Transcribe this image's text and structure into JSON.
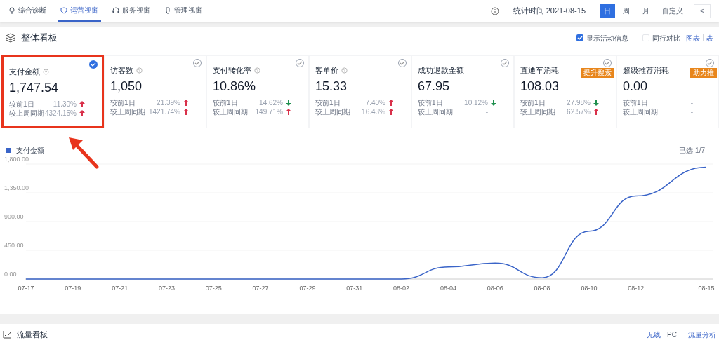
{
  "nav_tabs": [
    {
      "label": "综合诊断",
      "selected": false
    },
    {
      "label": "运营视窗",
      "selected": true
    },
    {
      "label": "服务视窗",
      "selected": false
    },
    {
      "label": "管理视窗",
      "selected": false
    }
  ],
  "stat_time": "统计时间 2021-08-15",
  "period_tabs": [
    {
      "label": "日",
      "selected": true
    },
    {
      "label": "周",
      "selected": false
    },
    {
      "label": "月",
      "selected": false
    },
    {
      "label": "自定义",
      "selected": false
    }
  ],
  "back_button": "<",
  "section": {
    "title": "整体看板",
    "show_activity": {
      "label": "显示活动信息",
      "checked": true
    },
    "peer_compare": {
      "label": "同行对比",
      "checked": false
    },
    "view_links": [
      "图表",
      "表"
    ]
  },
  "metrics": [
    {
      "label": "支付金额",
      "help": true,
      "value": "1,747.54",
      "selected": true,
      "highlighted": true,
      "rows": [
        {
          "label": "较前1日",
          "value": "11.30%",
          "increase": true
        },
        {
          "label": "较上周同期",
          "value": "4324.15%",
          "increase": true
        }
      ]
    },
    {
      "label": "访客数",
      "help": true,
      "value": "1,050",
      "selected": false,
      "highlighted": false,
      "rows": [
        {
          "label": "较前1日",
          "value": "21.39%",
          "increase": true
        },
        {
          "label": "较上周同期",
          "value": "1421.74%",
          "increase": true
        }
      ]
    },
    {
      "label": "支付转化率",
      "help": true,
      "value": "10.86%",
      "selected": false,
      "highlighted": false,
      "rows": [
        {
          "label": "较前1日",
          "value": "14.62%",
          "increase": false
        },
        {
          "label": "较上周同期",
          "value": "149.71%",
          "increase": true
        }
      ]
    },
    {
      "label": "客单价",
      "help": true,
      "value": "15.33",
      "selected": false,
      "highlighted": false,
      "rows": [
        {
          "label": "较前1日",
          "value": "7.40%",
          "increase": true
        },
        {
          "label": "较上周同期",
          "value": "16.43%",
          "increase": true
        }
      ]
    },
    {
      "label": "成功退款金额",
      "help": false,
      "value": "67.95",
      "selected": false,
      "highlighted": false,
      "rows": [
        {
          "label": "较前1日",
          "value": "10.12%",
          "increase": false
        },
        {
          "label": "较上周同期",
          "value": "-"
        }
      ]
    },
    {
      "label": "直通车消耗",
      "help": false,
      "value": "108.03",
      "selected": false,
      "highlighted": false,
      "badge": "提升搜索",
      "rows": [
        {
          "label": "较前1日",
          "value": "27.98%",
          "increase": false
        },
        {
          "label": "较上周同期",
          "value": "62.57%",
          "increase": true
        }
      ]
    },
    {
      "label": "超级推荐消耗",
      "help": false,
      "value": "0.00",
      "selected": false,
      "highlighted": false,
      "badge": "助力推",
      "rows": [
        {
          "label": "较前1日",
          "value": "-"
        },
        {
          "label": "较上周同期",
          "value": "-"
        }
      ]
    }
  ],
  "selected_count": "已选 1/7",
  "chart_data": {
    "type": "line",
    "grid": true,
    "categories": [
      "07-17",
      "07-19",
      "07-21",
      "07-23",
      "07-25",
      "07-27",
      "07-29",
      "07-31",
      "08-02",
      "08-04",
      "08-06",
      "08-08",
      "08-10",
      "08-12",
      "08-15"
    ],
    "series": [
      {
        "name": "支付金额",
        "color": "#3a64c8",
        "values": [
          0,
          0,
          0,
          0,
          0,
          0,
          0,
          0,
          0,
          190,
          250,
          20,
          750,
          1300,
          1750
        ]
      }
    ],
    "ylim": [
      0,
      1800
    ],
    "yticks": [
      {
        "value": 0,
        "label": "0.00"
      },
      {
        "value": 450,
        "label": "450.00"
      },
      {
        "value": 900,
        "label": "900.00"
      },
      {
        "value": 1350,
        "label": "1,350.00"
      },
      {
        "value": 1800,
        "label": "1,800.00"
      }
    ]
  },
  "traffic_section": {
    "title": "流量看板",
    "links": [
      "无线",
      "PC",
      "流量分析"
    ]
  }
}
